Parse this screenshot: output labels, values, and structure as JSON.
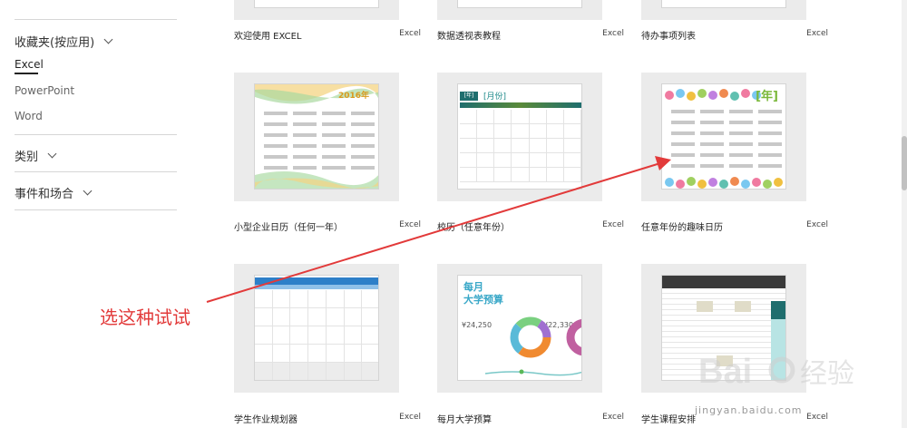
{
  "sidebar": {
    "favorites_heading": "收藏夹(按应用)",
    "apps": [
      "Excel",
      "PowerPoint",
      "Word"
    ],
    "category_heading": "类别",
    "events_heading": "事件和场合"
  },
  "tiles": [
    {
      "name": "欢迎使用 EXCEL",
      "app": "Excel"
    },
    {
      "name": "数据透视表教程",
      "app": "Excel"
    },
    {
      "name": "待办事项列表",
      "app": "Excel"
    },
    {
      "name": "小型企业日历（任何一年）",
      "app": "Excel",
      "thumb_year": "2016年"
    },
    {
      "name": "校历（任意年份）",
      "app": "Excel",
      "thumb_a": "[年]",
      "thumb_b": "[月份]"
    },
    {
      "name": "任意年份的趣味日历",
      "app": "Excel",
      "thumb_year": "[年]"
    },
    {
      "name": "学生作业规划器",
      "app": "Excel"
    },
    {
      "name": "每月大学预算",
      "app": "Excel",
      "thumb_title_1": "每月",
      "thumb_title_2": "大学预算",
      "thumb_amount_1": "¥24,250",
      "thumb_amount_2": "¥22,330"
    },
    {
      "name": "学生课程安排",
      "app": "Excel"
    }
  ],
  "annotation": {
    "text": "选这种试试",
    "color": "#e23a3a"
  },
  "watermark": {
    "text": "Baidu经验",
    "url": "jingyan.baidu.com"
  },
  "colors": {
    "excel_green": "#217346",
    "accent_teal": "#1f6e6e",
    "arrow_red": "#e23a3a"
  }
}
